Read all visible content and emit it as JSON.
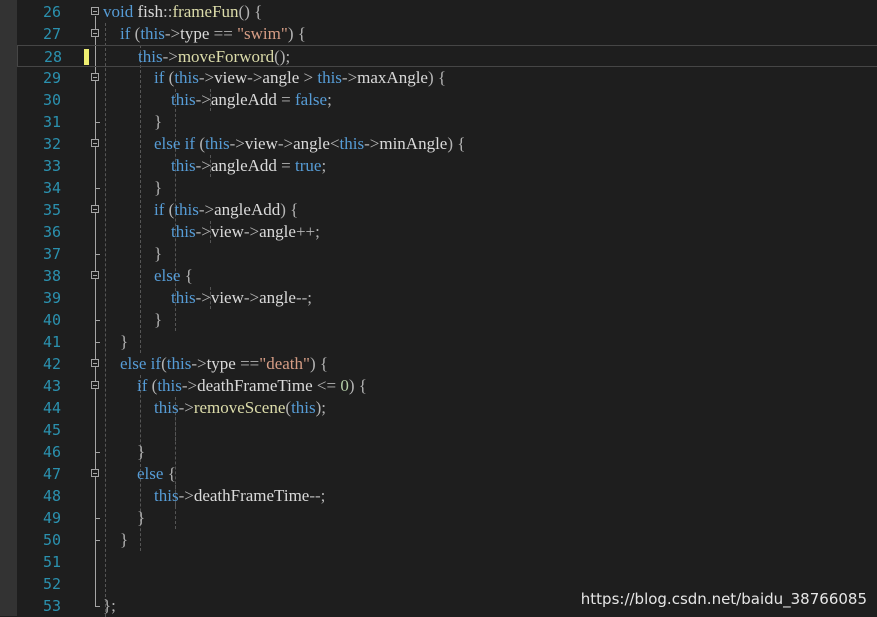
{
  "editor": {
    "colors": {
      "background": "#1e1e1e",
      "line_number": "#2b91af",
      "keyword": "#569cd6",
      "string": "#d69d85",
      "number": "#b5cea8",
      "function": "#dcdcaa",
      "modified_marker": "#efef71"
    },
    "current_line": 28,
    "lines": [
      {
        "n": "26",
        "fold": "open",
        "tokens": [
          {
            "t": "",
            "c": "ws"
          }
        ]
      },
      {
        "n": "27",
        "fold": "open"
      },
      {
        "n": "28",
        "modified": true
      },
      {
        "n": "29",
        "fold": "open"
      },
      {
        "n": "30"
      },
      {
        "n": "31",
        "fold": "end"
      },
      {
        "n": "32",
        "fold": "open"
      },
      {
        "n": "33"
      },
      {
        "n": "34",
        "fold": "end"
      },
      {
        "n": "35",
        "fold": "open"
      },
      {
        "n": "36"
      },
      {
        "n": "37",
        "fold": "end"
      },
      {
        "n": "38",
        "fold": "open"
      },
      {
        "n": "39"
      },
      {
        "n": "40",
        "fold": "end"
      },
      {
        "n": "41",
        "fold": "end"
      },
      {
        "n": "42",
        "fold": "open"
      },
      {
        "n": "43",
        "fold": "open"
      },
      {
        "n": "44"
      },
      {
        "n": "45"
      },
      {
        "n": "46",
        "fold": "end"
      },
      {
        "n": "47",
        "fold": "open"
      },
      {
        "n": "48"
      },
      {
        "n": "49",
        "fold": "end"
      },
      {
        "n": "50",
        "fold": "end"
      },
      {
        "n": "51"
      },
      {
        "n": "52"
      },
      {
        "n": "53",
        "fold": "end"
      }
    ],
    "code": [
      [
        [
          "kw",
          "void"
        ],
        [
          "id",
          " fish"
        ],
        [
          "op",
          "::"
        ],
        [
          "fn",
          "frameFun"
        ],
        [
          "op",
          "() {"
        ]
      ],
      [
        [
          "ws",
          "    "
        ],
        [
          "kw",
          "if"
        ],
        [
          "op",
          " ("
        ],
        [
          "kw",
          "this"
        ],
        [
          "op",
          "->"
        ],
        [
          "id",
          "type"
        ],
        [
          "op",
          " == "
        ],
        [
          "str",
          "\"swim\""
        ],
        [
          "op",
          ") {"
        ]
      ],
      [
        [
          "ws",
          "        "
        ],
        [
          "kw",
          "this"
        ],
        [
          "op",
          "->"
        ],
        [
          "fn",
          "moveForword"
        ],
        [
          "op",
          "();"
        ]
      ],
      [
        [
          "ws",
          "            "
        ],
        [
          "kw",
          "if"
        ],
        [
          "op",
          " ("
        ],
        [
          "kw",
          "this"
        ],
        [
          "op",
          "->"
        ],
        [
          "id",
          "view"
        ],
        [
          "op",
          "->"
        ],
        [
          "id",
          "angle"
        ],
        [
          "op",
          " > "
        ],
        [
          "kw",
          "this"
        ],
        [
          "op",
          "->"
        ],
        [
          "id",
          "maxAngle"
        ],
        [
          "op",
          ") {"
        ]
      ],
      [
        [
          "ws",
          "                "
        ],
        [
          "kw",
          "this"
        ],
        [
          "op",
          "->"
        ],
        [
          "id",
          "angleAdd"
        ],
        [
          "op",
          " = "
        ],
        [
          "kw",
          "false"
        ],
        [
          "op",
          ";"
        ]
      ],
      [
        [
          "ws",
          "            "
        ],
        [
          "op",
          "}"
        ]
      ],
      [
        [
          "ws",
          "            "
        ],
        [
          "kw",
          "else if"
        ],
        [
          "op",
          " ("
        ],
        [
          "kw",
          "this"
        ],
        [
          "op",
          "->"
        ],
        [
          "id",
          "view"
        ],
        [
          "op",
          "->"
        ],
        [
          "id",
          "angle"
        ],
        [
          "op",
          "<"
        ],
        [
          "kw",
          "this"
        ],
        [
          "op",
          "->"
        ],
        [
          "id",
          "minAngle"
        ],
        [
          "op",
          ") {"
        ]
      ],
      [
        [
          "ws",
          "                "
        ],
        [
          "kw",
          "this"
        ],
        [
          "op",
          "->"
        ],
        [
          "id",
          "angleAdd"
        ],
        [
          "op",
          " = "
        ],
        [
          "kw",
          "true"
        ],
        [
          "op",
          ";"
        ]
      ],
      [
        [
          "ws",
          "            "
        ],
        [
          "op",
          "}"
        ]
      ],
      [
        [
          "ws",
          "            "
        ],
        [
          "kw",
          "if"
        ],
        [
          "op",
          " ("
        ],
        [
          "kw",
          "this"
        ],
        [
          "op",
          "->"
        ],
        [
          "id",
          "angleAdd"
        ],
        [
          "op",
          ") {"
        ]
      ],
      [
        [
          "ws",
          "                "
        ],
        [
          "kw",
          "this"
        ],
        [
          "op",
          "->"
        ],
        [
          "id",
          "view"
        ],
        [
          "op",
          "->"
        ],
        [
          "id",
          "angle"
        ],
        [
          "op",
          "++;"
        ]
      ],
      [
        [
          "ws",
          "            "
        ],
        [
          "op",
          "}"
        ]
      ],
      [
        [
          "ws",
          "            "
        ],
        [
          "kw",
          "else"
        ],
        [
          "op",
          " {"
        ]
      ],
      [
        [
          "ws",
          "                "
        ],
        [
          "kw",
          "this"
        ],
        [
          "op",
          "->"
        ],
        [
          "id",
          "view"
        ],
        [
          "op",
          "->"
        ],
        [
          "id",
          "angle"
        ],
        [
          "op",
          "--;"
        ]
      ],
      [
        [
          "ws",
          "            "
        ],
        [
          "op",
          "}"
        ]
      ],
      [
        [
          "ws",
          "    "
        ],
        [
          "op",
          "}"
        ]
      ],
      [
        [
          "ws",
          "    "
        ],
        [
          "kw",
          "else if"
        ],
        [
          "op",
          "("
        ],
        [
          "kw",
          "this"
        ],
        [
          "op",
          "->"
        ],
        [
          "id",
          "type"
        ],
        [
          "op",
          " =="
        ],
        [
          "str",
          "\"death\""
        ],
        [
          "op",
          ") {"
        ]
      ],
      [
        [
          "ws",
          "        "
        ],
        [
          "kw",
          "if"
        ],
        [
          "op",
          " ("
        ],
        [
          "kw",
          "this"
        ],
        [
          "op",
          "->"
        ],
        [
          "id",
          "deathFrameTime"
        ],
        [
          "op",
          " <= "
        ],
        [
          "num",
          "0"
        ],
        [
          "op",
          ") {"
        ]
      ],
      [
        [
          "ws",
          "            "
        ],
        [
          "kw",
          "this"
        ],
        [
          "op",
          "->"
        ],
        [
          "fn",
          "removeScene"
        ],
        [
          "op",
          "("
        ],
        [
          "kw",
          "this"
        ],
        [
          "op",
          ");"
        ]
      ],
      [],
      [
        [
          "ws",
          "        "
        ],
        [
          "op",
          "}"
        ]
      ],
      [
        [
          "ws",
          "        "
        ],
        [
          "kw",
          "else"
        ],
        [
          "op",
          " {"
        ]
      ],
      [
        [
          "ws",
          "            "
        ],
        [
          "kw",
          "this"
        ],
        [
          "op",
          "->"
        ],
        [
          "id",
          "deathFrameTime"
        ],
        [
          "op",
          "--;"
        ]
      ],
      [
        [
          "ws",
          "        "
        ],
        [
          "op",
          "}"
        ]
      ],
      [
        [
          "ws",
          "    "
        ],
        [
          "op",
          "}"
        ]
      ],
      [],
      [],
      [
        [
          "op",
          "};"
        ]
      ]
    ]
  },
  "watermark": "https://blog.csdn.net/baidu_38766085"
}
